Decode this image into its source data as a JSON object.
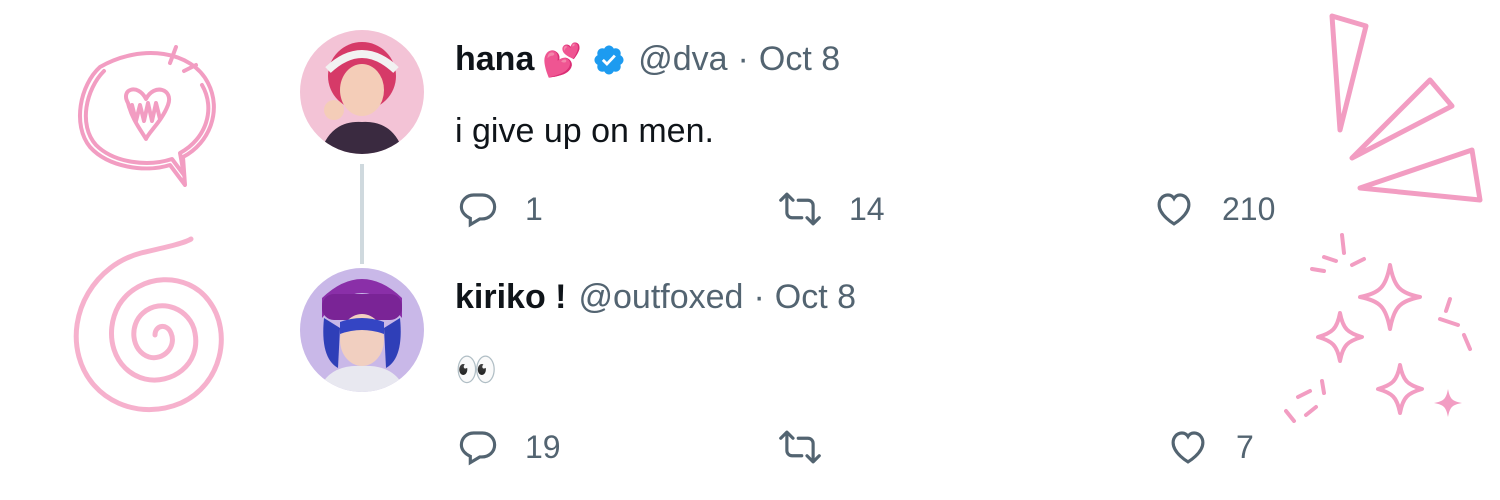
{
  "thread": [
    {
      "name": "hana",
      "name_emoji": "💕",
      "verified": true,
      "handle": "@dva",
      "separator": "·",
      "date": "Oct 8",
      "text": "i give up on men.",
      "stats": {
        "replies": "1",
        "retweets": "14",
        "likes": "210"
      }
    },
    {
      "name": "kiriko !",
      "verified": false,
      "handle": "@outfoxed",
      "separator": "·",
      "date": "Oct 8",
      "text": "👀",
      "stats": {
        "replies": "19",
        "retweets": "",
        "likes": "7"
      }
    }
  ],
  "colors": {
    "text_primary": "#0f1419",
    "text_secondary": "#536471",
    "verified_blue": "#1d9bf0",
    "thread_line": "#cfd9de",
    "decoration_pink": "#f08cb8"
  },
  "icons": [
    "reply-icon",
    "retweet-icon",
    "like-icon",
    "verified-badge-icon"
  ]
}
